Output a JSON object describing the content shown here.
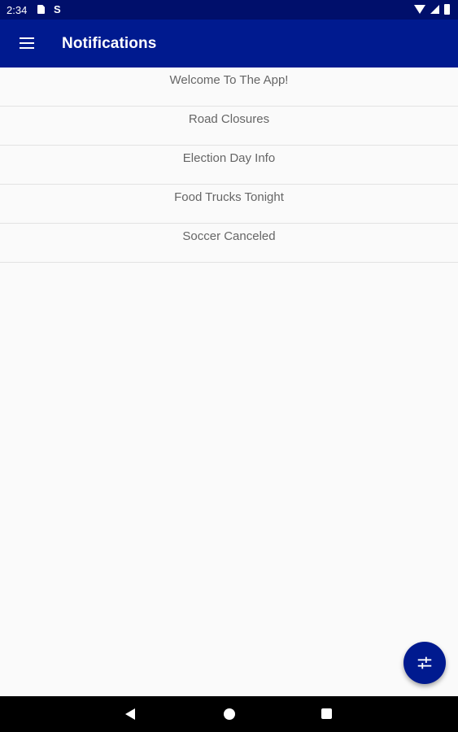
{
  "status_bar": {
    "time": "2:34",
    "sd_icon": "sd-card-icon",
    "s_icon": "s-notification-icon",
    "wifi_icon": "wifi-icon",
    "signal_icon": "cell-signal-icon",
    "battery_icon": "battery-icon"
  },
  "app_bar": {
    "title": "Notifications",
    "menu_icon": "hamburger-menu-icon",
    "background_color": "#001a8f"
  },
  "notifications": [
    {
      "title": "Welcome To The App!"
    },
    {
      "title": "Road Closures"
    },
    {
      "title": "Election Day Info"
    },
    {
      "title": "Food Trucks Tonight"
    },
    {
      "title": "Soccer Canceled"
    }
  ],
  "fab": {
    "icon": "filter-sliders-icon",
    "color": "#001a8f"
  },
  "nav_bar": {
    "back_icon": "back-triangle-icon",
    "home_icon": "home-circle-icon",
    "recents_icon": "recents-square-icon"
  }
}
